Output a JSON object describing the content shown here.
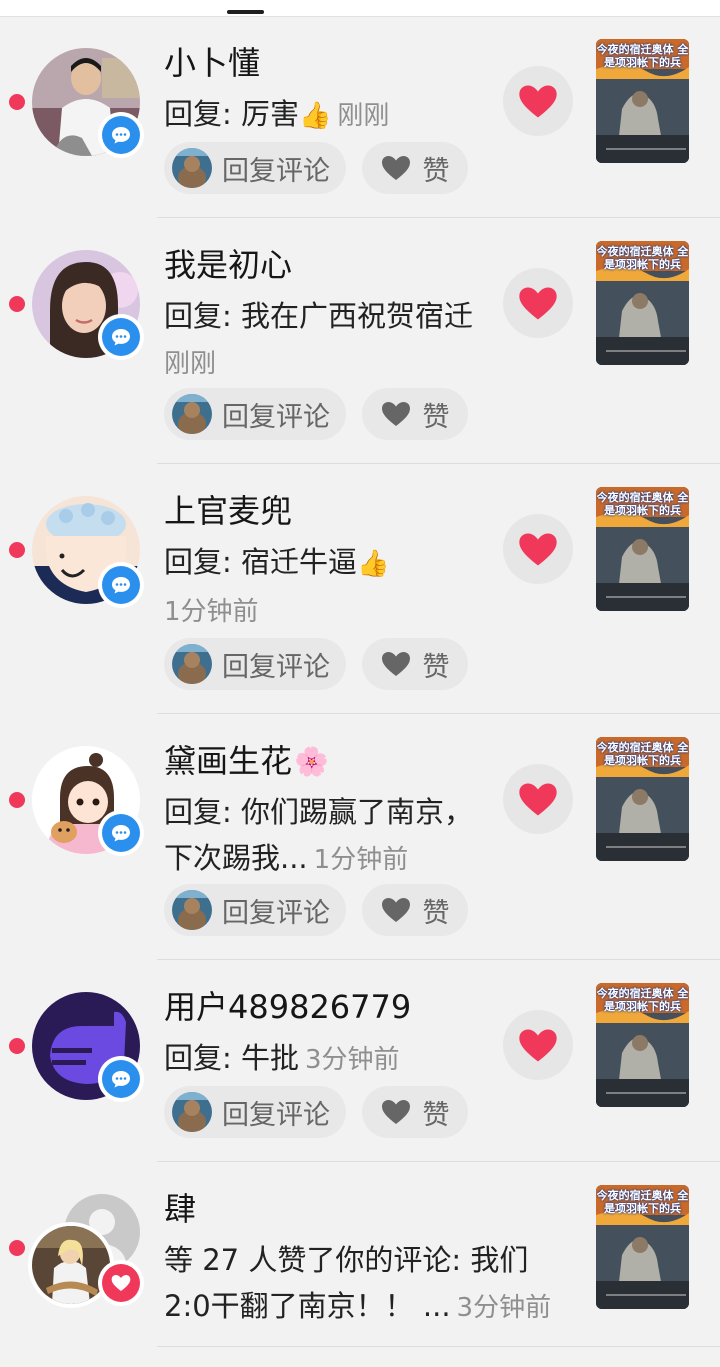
{
  "colors": {
    "background": "#f2f2f2",
    "unread_dot": "#f0395a",
    "comment_badge": "#2b8fee",
    "like_badge": "#f0395a",
    "heart": "#f0395a",
    "secondary_text": "#8f8f8f"
  },
  "video_thumb_caption": "今夜的宿迁奥体 全是项羽帐下的兵",
  "notifications": [
    {
      "name": "小卜懂",
      "name_emoji": "",
      "body": "回复: 厉害",
      "body_emoji": "👍",
      "time": "刚刚",
      "badge_icon": "comment-bubble-icon",
      "reply_label": "回复评论",
      "like_label": "赞"
    },
    {
      "name": "我是初心",
      "name_emoji": "",
      "body": "回复: 我在广西祝贺宿迁",
      "body_emoji": "",
      "time": "刚刚",
      "badge_icon": "comment-bubble-icon",
      "reply_label": "回复评论",
      "like_label": "赞"
    },
    {
      "name": "上官麦兜",
      "name_emoji": "",
      "body": "回复: 宿迁牛逼",
      "body_emoji": "👍",
      "time": "1分钟前",
      "badge_icon": "comment-bubble-icon",
      "reply_label": "回复评论",
      "like_label": "赞"
    },
    {
      "name": "黛画生花",
      "name_emoji": "🌸",
      "body": "回复: 你们踢赢了南京，下次踢我...",
      "body_emoji": "",
      "time": "1分钟前",
      "badge_icon": "comment-bubble-icon",
      "reply_label": "回复评论",
      "like_label": "赞"
    },
    {
      "name": "用户489826779",
      "name_emoji": "",
      "body": "回复: 牛批",
      "body_emoji": "",
      "time": "3分钟前",
      "badge_icon": "comment-bubble-icon",
      "reply_label": "回复评论",
      "like_label": "赞"
    },
    {
      "name": "肆",
      "name_emoji": "",
      "body": "等 27 人赞了你的评论: 我们2:0干翻了南京！！ ...",
      "body_emoji": "",
      "time": "3分钟前",
      "badge_icon": "heart-icon"
    }
  ]
}
